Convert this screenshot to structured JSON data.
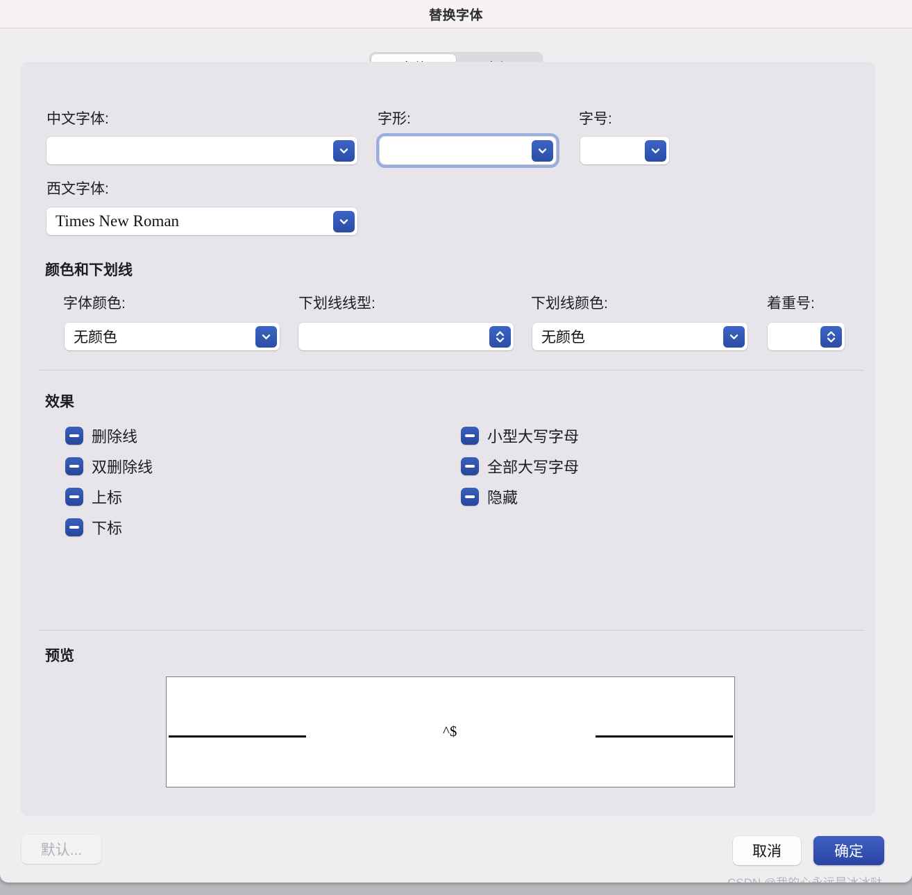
{
  "window": {
    "title": "替换字体"
  },
  "tabs": [
    {
      "label": "字体",
      "active": true
    },
    {
      "label": "高级",
      "active": false
    }
  ],
  "font_section": {
    "chinese_font_label": "中文字体:",
    "chinese_font_value": "",
    "western_font_label": "西文字体:",
    "western_font_value": "Times New Roman",
    "style_label": "字形:",
    "style_value": "",
    "size_label": "字号:",
    "size_value": ""
  },
  "color_section": {
    "heading": "颜色和下划线",
    "font_color_label": "字体颜色:",
    "font_color_value": "无颜色",
    "underline_style_label": "下划线线型:",
    "underline_style_value": "",
    "underline_color_label": "下划线颜色:",
    "underline_color_value": "无颜色",
    "emphasis_label": "着重号:",
    "emphasis_value": ""
  },
  "effects_section": {
    "heading": "效果",
    "left_items": [
      {
        "label": "删除线",
        "state": "mixed"
      },
      {
        "label": "双删除线",
        "state": "mixed"
      },
      {
        "label": "上标",
        "state": "mixed"
      },
      {
        "label": "下标",
        "state": "mixed"
      }
    ],
    "right_items": [
      {
        "label": "小型大写字母",
        "state": "mixed"
      },
      {
        "label": "全部大写字母",
        "state": "mixed"
      },
      {
        "label": "隐藏",
        "state": "mixed"
      }
    ]
  },
  "preview_section": {
    "heading": "预览",
    "sample_text": "^$"
  },
  "footer": {
    "default_label": "默认...",
    "cancel_label": "取消",
    "ok_label": "确定"
  },
  "watermark": "CSDN @我的心永远是冰冰哒",
  "colors": {
    "accent": "#2f52ac",
    "window_bg": "#efedf0",
    "panel_bg": "#e7e5e9",
    "titlebar_bg": "#f6f2f6"
  }
}
